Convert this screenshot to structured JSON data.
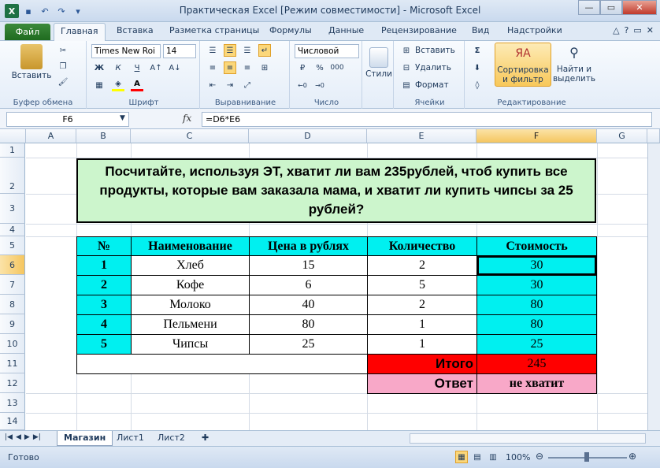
{
  "window": {
    "title": "Практическая Excel  [Режим совместимости]  -  Microsoft Excel"
  },
  "tabs": {
    "file": "Файл",
    "items": [
      "Главная",
      "Вставка",
      "Разметка страницы",
      "Формулы",
      "Данные",
      "Рецензирование",
      "Вид",
      "Надстройки"
    ]
  },
  "ribbon": {
    "clipboard": {
      "label": "Буфер обмена",
      "paste": "Вставить"
    },
    "font": {
      "label": "Шрифт",
      "name": "Times New Roi",
      "size": "14",
      "bold": "Ж",
      "italic": "К",
      "underline": "Ч"
    },
    "alignment": {
      "label": "Выравнивание"
    },
    "number": {
      "label": "Число",
      "format": "Числовой",
      "percent": "%",
      "thousands": "000"
    },
    "styles": {
      "label": "Стили"
    },
    "cells": {
      "label": "Ячейки",
      "insert": "Вставить",
      "delete": "Удалить",
      "format": "Формат"
    },
    "editing": {
      "label": "Редактирование",
      "sort_line1": "Сортировка",
      "sort_line2": "и фильтр",
      "find_line1": "Найти и",
      "find_line2": "выделить"
    }
  },
  "formula_bar": {
    "name_box": "F6",
    "fx": "fx",
    "formula": "=D6*E6"
  },
  "columns": [
    "A",
    "B",
    "C",
    "D",
    "E",
    "F",
    "G"
  ],
  "rows": [
    "1",
    "2",
    "3",
    "4",
    "5",
    "6",
    "7",
    "8",
    "9",
    "10",
    "11",
    "12",
    "13",
    "14"
  ],
  "banner": {
    "text": "Посчитайте, используя ЭТ, хватит ли вам 235рублей, чтоб купить все продукты, которые вам заказала мама, и хватит ли купить чипсы за 25 рублей?"
  },
  "table": {
    "headers": [
      "№",
      "Наименование",
      "Цена в рублях",
      "Количество",
      "Стоимость"
    ],
    "rows": [
      [
        "1",
        "Хлеб",
        "15",
        "2",
        "30"
      ],
      [
        "2",
        "Кофе",
        "6",
        "5",
        "30"
      ],
      [
        "3",
        "Молоко",
        "40",
        "2",
        "80"
      ],
      [
        "4",
        "Пельмени",
        "80",
        "1",
        "80"
      ],
      [
        "5",
        "Чипсы",
        "25",
        "1",
        "25"
      ]
    ],
    "total_label": "Итого",
    "total_value": "245",
    "answer_label": "Ответ",
    "answer_value": "не хватит"
  },
  "sheets": [
    "Магазин",
    "Лист1",
    "Лист2"
  ],
  "status": {
    "ready": "Готово",
    "zoom": "100%"
  },
  "colors": {
    "cyan": "#00f0f0",
    "red": "#ff0000",
    "pink": "#f8a8c8",
    "banner": "#ccf5cc"
  }
}
